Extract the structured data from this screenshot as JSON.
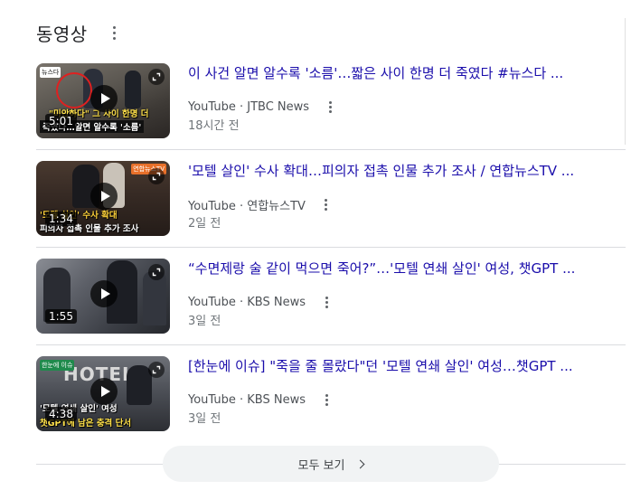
{
  "section": {
    "title": "동영상",
    "menu_icon": "more-vert-icon"
  },
  "videos": [
    {
      "title": "이 사건 알면 알수록 '소름'…짧은 사이 한명 더 죽였다 #뉴스다 ...",
      "platform": "YouTube",
      "channel": "JTBC News",
      "source": "YouTube · JTBC News",
      "date": "18시간 전",
      "duration": "5:01",
      "thumb_caption_1": "\"미안하다\" 그 사이 한명 더",
      "thumb_caption_2": "죽였다…알면 알수록 '소름'",
      "thumb_badge": "뉴스다"
    },
    {
      "title": "'모텔 살인' 수사 확대…피의자 접촉 인물 추가 조사 / 연합뉴스TV ...",
      "platform": "YouTube",
      "channel": "연합뉴스TV",
      "source": "YouTube · 연합뉴스TV",
      "date": "2일 전",
      "duration": "1:34",
      "thumb_caption_1": "'모텔 살인' 수사 확대",
      "thumb_caption_2": "피의자 접촉 인물 추가 조사",
      "thumb_badge": "연합뉴스TV"
    },
    {
      "title": "“수면제랑 술 같이 먹으면 죽어?”…'모텔 연쇄 살인' 여성, 챗GPT ...",
      "platform": "YouTube",
      "channel": "KBS News",
      "source": "YouTube · KBS News",
      "date": "3일 전",
      "duration": "1:55"
    },
    {
      "title": "[한눈에 이슈] \"죽을 줄 몰랐다\"던 '모텔 연쇄 살인' 여성…챗GPT ...",
      "platform": "YouTube",
      "channel": "KBS News",
      "source": "YouTube · KBS News",
      "date": "3일 전",
      "duration": "4:38",
      "thumb_caption_1": "'모텔 연쇄 살인' 여성",
      "thumb_caption_2": "챗GPT에 남은 충격 단서",
      "thumb_badge": "한눈에 이슈",
      "thumb_sign": "HOTEL"
    }
  ],
  "more_button": {
    "label": "모두 보기",
    "icon": "chevron-right-icon"
  },
  "colors": {
    "title_link": "#1a0dab",
    "meta_text": "#4d5156",
    "date_text": "#70757a",
    "more_bg": "#f1f3f4"
  }
}
